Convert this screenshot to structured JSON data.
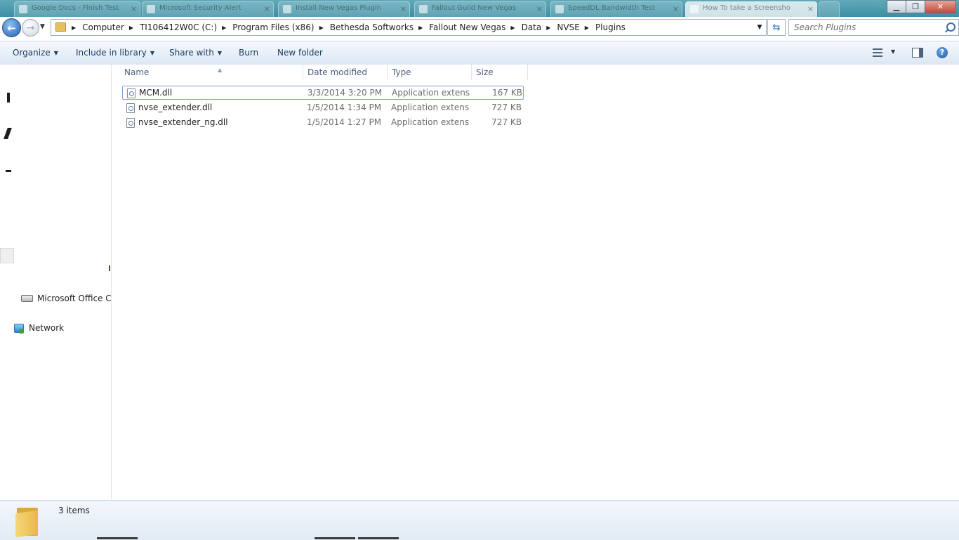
{
  "browser_tabs": [
    {
      "label": "Google Docs - Finish Test"
    },
    {
      "label": "Microsoft Security Alert"
    },
    {
      "label": "Install New Vegas Plugin"
    },
    {
      "label": "Fallout Guild New Vegas"
    },
    {
      "label": "SpeedDL Bandwidth Test"
    },
    {
      "label": "How To take a Screensho"
    }
  ],
  "window_buttons": {
    "minimize": "▁",
    "maximize": "❐",
    "close": "✕"
  },
  "address_bar": {
    "breadcrumb": [
      "Computer",
      "TI106412W0C (C:)",
      "Program Files (x86)",
      "Bethesda Softworks",
      "Fallout New Vegas",
      "Data",
      "NVSE",
      "Plugins"
    ]
  },
  "search": {
    "placeholder": "Search Plugins"
  },
  "toolbar": {
    "organize": "Organize",
    "include_in_library": "Include in library",
    "share_with": "Share with",
    "burn": "Burn",
    "new_folder": "New folder",
    "help": "?"
  },
  "nav_pane": {
    "items": [
      {
        "label": "Microsoft Office Click-to-Run",
        "icon": "drive-icon"
      },
      {
        "label": "Network",
        "icon": "network-icon"
      }
    ]
  },
  "file_list": {
    "columns": [
      "Name",
      "Date modified",
      "Type",
      "Size"
    ],
    "rows": [
      {
        "name": "MCM.dll",
        "date": "3/3/2014 3:20 PM",
        "type": "Application extens...",
        "size": "167 KB",
        "selected": true
      },
      {
        "name": "nvse_extender.dll",
        "date": "1/5/2014 1:34 PM",
        "type": "Application extens...",
        "size": "727 KB",
        "selected": false
      },
      {
        "name": "nvse_extender_ng.dll",
        "date": "1/5/2014 1:27 PM",
        "type": "Application extens...",
        "size": "727 KB",
        "selected": false
      }
    ]
  },
  "status": {
    "item_count": "3 items"
  },
  "colors": {
    "accent": "#1e5fb0",
    "command_text": "#1e3e63",
    "selection_border": "#7da2ce"
  }
}
